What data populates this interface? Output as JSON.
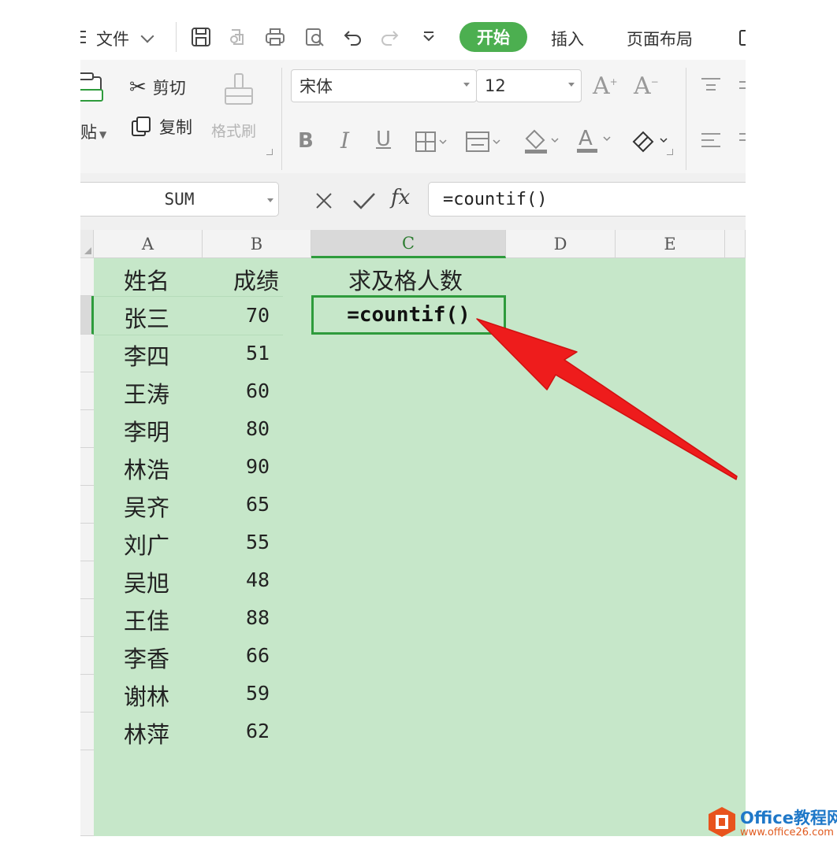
{
  "menubar": {
    "file_label": "文件",
    "start_tab": "开始",
    "insert_tab": "插入",
    "page_layout_tab": "页面布局"
  },
  "ribbon": {
    "paste_label": "贴",
    "cut_label": "剪切",
    "copy_label": "复制",
    "format_painter_label": "格式刷",
    "font_name": "宋体",
    "font_size": "12"
  },
  "formula_bar": {
    "name_box": "SUM",
    "fx_label": "fx",
    "formula": "=countif()"
  },
  "grid": {
    "columns": [
      "A",
      "B",
      "C",
      "D",
      "E"
    ],
    "active_column": "C",
    "headers": {
      "name": "姓名",
      "score": "成绩",
      "pass_count": "求及格人数"
    },
    "rows": [
      {
        "name": "张三",
        "score": "70"
      },
      {
        "name": "李四",
        "score": "51"
      },
      {
        "name": "王涛",
        "score": "60"
      },
      {
        "name": "李明",
        "score": "80"
      },
      {
        "name": "林浩",
        "score": "90"
      },
      {
        "name": "吴齐",
        "score": "65"
      },
      {
        "name": "刘广",
        "score": "55"
      },
      {
        "name": "吴旭",
        "score": "48"
      },
      {
        "name": "王佳",
        "score": "88"
      },
      {
        "name": "李香",
        "score": "66"
      },
      {
        "name": "谢林",
        "score": "59"
      },
      {
        "name": "林萍",
        "score": "62"
      }
    ],
    "active_cell_value": "=countif()"
  },
  "watermark": {
    "title": "Office教程网",
    "url": "www.office26.com"
  },
  "colors": {
    "accent_green": "#4caf50",
    "sheet_green": "#c6e7c9",
    "arrow_red": "#ee1c1c"
  }
}
